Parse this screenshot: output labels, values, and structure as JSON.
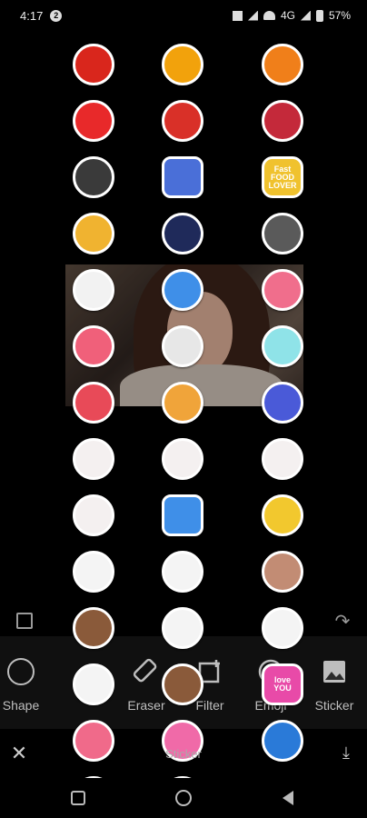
{
  "status_bar": {
    "time": "4:17",
    "notif_badge": "2",
    "signal_label": "4G",
    "battery": "57%"
  },
  "stickers": [
    {
      "icon": "chili-sticker",
      "color": "#d9261c",
      "label": "",
      "sq": false
    },
    {
      "icon": "pepper-sticker",
      "color": "#f2a20c",
      "label": "",
      "sq": false
    },
    {
      "icon": "carrot-sticker",
      "color": "#f07f1a",
      "label": "",
      "sq": false
    },
    {
      "icon": "strawberry-sticker",
      "color": "#e8292a",
      "label": "",
      "sq": false
    },
    {
      "icon": "tomato-sticker",
      "color": "#d93028",
      "label": "",
      "sq": false
    },
    {
      "icon": "wine-glass-sticker",
      "color": "#c4293a",
      "label": "",
      "sq": false
    },
    {
      "icon": "rocking-horse-sticker",
      "color": "#3a3a3a",
      "label": "",
      "sq": false
    },
    {
      "icon": "book-sticker",
      "color": "#4a6fd8",
      "label": "",
      "sq": true
    },
    {
      "icon": "fast-food-lover-sticker",
      "color": "#f0c22e",
      "label": "Fast FOOD LOVER",
      "sq": true
    },
    {
      "icon": "party-hat-sticker",
      "color": "#f0b330",
      "label": "",
      "sq": false
    },
    {
      "icon": "witch-hat-sticker",
      "color": "#1f2a5a",
      "label": "",
      "sq": false
    },
    {
      "icon": "graduation-cap-sticker",
      "color": "#5a5a5a",
      "label": "",
      "sq": false
    },
    {
      "icon": "chef-hat-sticker",
      "color": "#f2f2f2",
      "label": "",
      "sq": false
    },
    {
      "icon": "party-hat-face-sticker",
      "color": "#3f8fe8",
      "label": "",
      "sq": false
    },
    {
      "icon": "beanie-sticker",
      "color": "#f06e8c",
      "label": "",
      "sq": false
    },
    {
      "icon": "pink-hat-sticker",
      "color": "#f0607a",
      "label": "",
      "sq": false
    },
    {
      "icon": "glasses-sticker",
      "color": "#e7e7e7",
      "label": "",
      "sq": false
    },
    {
      "icon": "sunglasses-sticker",
      "color": "#8fe3e8",
      "label": "",
      "sq": false
    },
    {
      "icon": "snorkel-sticker",
      "color": "#e84a58",
      "label": "",
      "sq": false
    },
    {
      "icon": "goggles-sticker",
      "color": "#f0a43a",
      "label": "",
      "sq": false
    },
    {
      "icon": "heart-glasses-sticker",
      "color": "#4a5ad8",
      "label": "",
      "sq": false
    },
    {
      "icon": "bunny-sticker",
      "color": "#f4f0f0",
      "label": "",
      "sq": false
    },
    {
      "icon": "bunny-sticker",
      "color": "#f4f0f0",
      "label": "",
      "sq": false
    },
    {
      "icon": "bunny-sticker",
      "color": "#f4f0f0",
      "label": "",
      "sq": false
    },
    {
      "icon": "bunny-wave-sticker",
      "color": "#f4f0f0",
      "label": "",
      "sq": false
    },
    {
      "icon": "phone-sticker",
      "color": "#3f8fe8",
      "label": "",
      "sq": true
    },
    {
      "icon": "star-sticker",
      "color": "#f2c82e",
      "label": "",
      "sq": false
    },
    {
      "icon": "panda-small-sticker",
      "color": "#f4f4f4",
      "label": "",
      "sq": false
    },
    {
      "icon": "panda-small-sticker",
      "color": "#f4f4f4",
      "label": "",
      "sq": false
    },
    {
      "icon": "bear-sticker",
      "color": "#c28c74",
      "label": "",
      "sq": false
    },
    {
      "icon": "bear-balloon-sticker",
      "color": "#8a5a3a",
      "label": "",
      "sq": false
    },
    {
      "icon": "panda-sticker",
      "color": "#f4f4f4",
      "label": "",
      "sq": false
    },
    {
      "icon": "panda-sticker",
      "color": "#f4f4f4",
      "label": "",
      "sq": false
    },
    {
      "icon": "panda-sitting-sticker",
      "color": "#f4f4f4",
      "label": "",
      "sq": false
    },
    {
      "icon": "bear-heart-sticker",
      "color": "#8a5a3a",
      "label": "",
      "sq": false
    },
    {
      "icon": "love-you-sticker",
      "color": "#e84aa8",
      "label": "love YOU",
      "sq": true
    },
    {
      "icon": "i-love-you-heart-sticker",
      "color": "#f06a8a",
      "label": "",
      "sq": false
    },
    {
      "icon": "heart-balloons-sticker",
      "color": "#f06aa8",
      "label": "",
      "sq": false
    },
    {
      "icon": "toucan-sticker",
      "color": "#2a7ad8",
      "label": "",
      "sq": false
    },
    {
      "icon": "whale-sticker",
      "color": "#2a8ad8",
      "label": "",
      "sq": false
    },
    {
      "icon": "succulent-sticker",
      "color": "#6ab04a",
      "label": "",
      "sq": false
    }
  ],
  "toolbar": {
    "tools": [
      {
        "name": "shape",
        "label": "Shape"
      },
      {
        "name": "eraser",
        "label": "Eraser"
      },
      {
        "name": "filter",
        "label": "Filter"
      },
      {
        "name": "emoji",
        "label": "Emoji"
      },
      {
        "name": "sticker",
        "label": "Sticker"
      }
    ]
  },
  "action_bar": {
    "title": "Sticker"
  }
}
